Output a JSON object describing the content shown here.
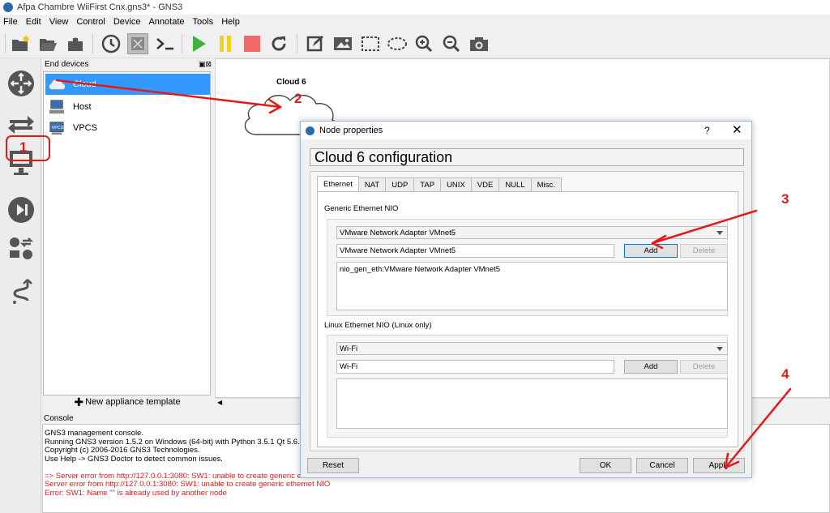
{
  "window": {
    "title": "Afpa Chambre WiiFirst Cnx.gns3* - GNS3"
  },
  "menu": [
    "File",
    "Edit",
    "View",
    "Control",
    "Device",
    "Annotate",
    "Tools",
    "Help"
  ],
  "toolbar_icons": [
    "new-project-icon",
    "open-project-icon",
    "save-project-icon",
    "history-icon",
    "snapshot-icon",
    "console-icon",
    "start-icon",
    "pause-icon",
    "stop-icon",
    "reload-icon",
    "note-icon",
    "image-icon",
    "rectangle-icon",
    "ellipse-icon",
    "zoom-in-icon",
    "zoom-out-icon",
    "screenshot-icon"
  ],
  "left_toolbar_icons": [
    "router-icon",
    "switch-icon",
    "end-device-icon",
    "security-device-icon",
    "all-devices-icon",
    "link-icon"
  ],
  "device_panel": {
    "title": "End devices",
    "items": [
      {
        "label": "Cloud",
        "selected": true,
        "icon": "cloud-icon"
      },
      {
        "label": "Host",
        "selected": false,
        "icon": "host-icon"
      },
      {
        "label": "VPCS",
        "selected": false,
        "icon": "vpcs-icon"
      }
    ],
    "new_template": "New appliance template"
  },
  "canvas": {
    "node_label": "Cloud 6"
  },
  "console": {
    "title": "Console",
    "lines": [
      "GNS3 management console.",
      "Running GNS3 version 1.5.2 on Windows (64-bit) with Python 3.5.1 Qt 5.6.0.",
      "Copyright (c) 2006-2016 GNS3 Technologies.",
      "Use Help -> GNS3 Doctor to detect common issues.",
      ""
    ],
    "error_lines": [
      "=> Server error from http://127.0.0.1:3080: SW1: unable to create generic eth",
      "Server error from http://127.0.0.1:3080: SW1: unable to create generic ethernet NIO",
      "Error: SW1: Name \"\" is already used by another node"
    ]
  },
  "dialog": {
    "title": "Node properties",
    "help": "?",
    "close": "✕",
    "header": "Cloud 6 configuration",
    "tabs": [
      "Ethernet",
      "NAT",
      "UDP",
      "TAP",
      "UNIX",
      "VDE",
      "NULL",
      "Misc."
    ],
    "active_tab": "Ethernet",
    "generic": {
      "title": "Generic Ethernet NIO",
      "combo": "VMware Network Adapter VMnet5",
      "field": "VMware Network Adapter VMnet5",
      "add": "Add",
      "delete": "Delete",
      "list": [
        "nio_gen_eth:VMware Network Adapter VMnet5"
      ]
    },
    "linux": {
      "title": "Linux Ethernet NIO (Linux only)",
      "combo": "Wi-Fi",
      "field": "Wi-Fi",
      "add": "Add",
      "delete": "Delete"
    },
    "buttons": {
      "reset": "Reset",
      "ok": "OK",
      "cancel": "Cancel",
      "apply": "Apply"
    }
  },
  "annotations": {
    "n1": "1",
    "n2": "2",
    "n3": "3",
    "n4": "4",
    "color": "#e31a1a"
  }
}
